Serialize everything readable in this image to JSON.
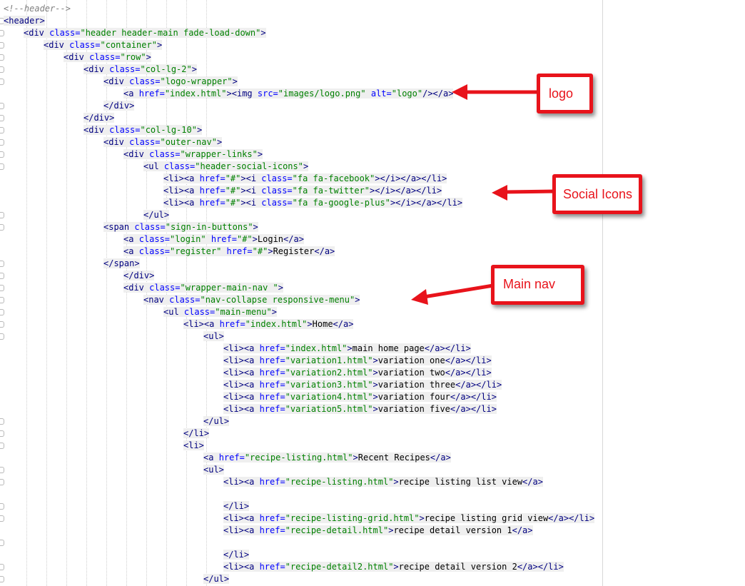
{
  "colors": {
    "tag": "#000080",
    "attr_name": "#0000ff",
    "attr_value": "#008000",
    "comment": "#808080",
    "text": "#000000",
    "annotation": "#e8131b"
  },
  "code_lines": [
    {
      "tokens": [
        {
          "t": "cm",
          "v": "<!--header-->"
        }
      ]
    },
    {
      "tokens": [
        {
          "t": "tag",
          "v": "<header>"
        }
      ]
    },
    {
      "tokens": [
        {
          "t": "tag",
          "v": "<div "
        },
        {
          "t": "an",
          "v": "class="
        },
        {
          "t": "av",
          "v": "\"header header-main fade-load-down\""
        },
        {
          "t": "tag",
          "v": ">"
        }
      ]
    },
    {
      "tokens": [
        {
          "t": "tag",
          "v": "<div "
        },
        {
          "t": "an",
          "v": "class="
        },
        {
          "t": "av",
          "v": "\"container\""
        },
        {
          "t": "tag",
          "v": ">"
        }
      ]
    },
    {
      "tokens": [
        {
          "t": "tag",
          "v": "<div "
        },
        {
          "t": "an",
          "v": "class="
        },
        {
          "t": "av",
          "v": "\"row\""
        },
        {
          "t": "tag",
          "v": ">"
        }
      ]
    },
    {
      "tokens": [
        {
          "t": "tag",
          "v": "<div "
        },
        {
          "t": "an",
          "v": "class="
        },
        {
          "t": "av",
          "v": "\"col-lg-2\""
        },
        {
          "t": "tag",
          "v": ">"
        }
      ]
    },
    {
      "tokens": [
        {
          "t": "tag",
          "v": "<div "
        },
        {
          "t": "an",
          "v": "class="
        },
        {
          "t": "av",
          "v": "\"logo-wrapper\""
        },
        {
          "t": "tag",
          "v": ">"
        }
      ]
    },
    {
      "tokens": [
        {
          "t": "tag",
          "v": "<a "
        },
        {
          "t": "an",
          "v": "href="
        },
        {
          "t": "av",
          "v": "\"index.html\""
        },
        {
          "t": "tag",
          "v": "><img "
        },
        {
          "t": "an",
          "v": "src="
        },
        {
          "t": "av",
          "v": "\"images/logo.png\""
        },
        {
          "t": "tag",
          "v": " "
        },
        {
          "t": "an",
          "v": "alt="
        },
        {
          "t": "av",
          "v": "\"logo\""
        },
        {
          "t": "tag",
          "v": "/></a>"
        }
      ]
    },
    {
      "tokens": [
        {
          "t": "tag",
          "v": "</div>"
        }
      ]
    },
    {
      "tokens": [
        {
          "t": "tag",
          "v": "</div>"
        }
      ]
    },
    {
      "tokens": [
        {
          "t": "tag",
          "v": "<div "
        },
        {
          "t": "an",
          "v": "class="
        },
        {
          "t": "av",
          "v": "\"col-lg-10\""
        },
        {
          "t": "tag",
          "v": ">"
        }
      ]
    },
    {
      "tokens": [
        {
          "t": "tag",
          "v": "<div "
        },
        {
          "t": "an",
          "v": "class="
        },
        {
          "t": "av",
          "v": "\"outer-nav\""
        },
        {
          "t": "tag",
          "v": ">"
        }
      ]
    },
    {
      "tokens": [
        {
          "t": "tag",
          "v": "<div "
        },
        {
          "t": "an",
          "v": "class="
        },
        {
          "t": "av",
          "v": "\"wrapper-links\""
        },
        {
          "t": "tag",
          "v": ">"
        }
      ]
    },
    {
      "tokens": [
        {
          "t": "tag",
          "v": "<ul "
        },
        {
          "t": "an",
          "v": "class="
        },
        {
          "t": "av",
          "v": "\"header-social-icons\""
        },
        {
          "t": "tag",
          "v": ">"
        }
      ]
    },
    {
      "tokens": [
        {
          "t": "tag",
          "v": "<li><a "
        },
        {
          "t": "an",
          "v": "href="
        },
        {
          "t": "av",
          "v": "\"#\""
        },
        {
          "t": "tag",
          "v": "><i "
        },
        {
          "t": "an",
          "v": "class="
        },
        {
          "t": "av",
          "v": "\"fa fa-facebook\""
        },
        {
          "t": "tag",
          "v": "></i></a></li>"
        }
      ]
    },
    {
      "tokens": [
        {
          "t": "tag",
          "v": "<li><a "
        },
        {
          "t": "an",
          "v": "href="
        },
        {
          "t": "av",
          "v": "\"#\""
        },
        {
          "t": "tag",
          "v": "><i "
        },
        {
          "t": "an",
          "v": "class="
        },
        {
          "t": "av",
          "v": "\"fa fa-twitter\""
        },
        {
          "t": "tag",
          "v": "></i></a></li>"
        }
      ]
    },
    {
      "tokens": [
        {
          "t": "tag",
          "v": "<li><a "
        },
        {
          "t": "an",
          "v": "href="
        },
        {
          "t": "av",
          "v": "\"#\""
        },
        {
          "t": "tag",
          "v": "><i "
        },
        {
          "t": "an",
          "v": "class="
        },
        {
          "t": "av",
          "v": "\"fa fa-google-plus\""
        },
        {
          "t": "tag",
          "v": "></i></a></li>"
        }
      ]
    },
    {
      "tokens": [
        {
          "t": "tag",
          "v": "</ul>"
        }
      ]
    },
    {
      "tokens": [
        {
          "t": "tag",
          "v": "<span "
        },
        {
          "t": "an",
          "v": "class="
        },
        {
          "t": "av",
          "v": "\"sign-in-buttons\""
        },
        {
          "t": "tag",
          "v": ">"
        }
      ]
    },
    {
      "tokens": [
        {
          "t": "tag",
          "v": "<a "
        },
        {
          "t": "an",
          "v": "class="
        },
        {
          "t": "av",
          "v": "\"login\""
        },
        {
          "t": "tag",
          "v": " "
        },
        {
          "t": "an",
          "v": "href="
        },
        {
          "t": "av",
          "v": "\"#\""
        },
        {
          "t": "tag",
          "v": ">"
        },
        {
          "t": "tx",
          "v": "Login"
        },
        {
          "t": "tag",
          "v": "</a>"
        }
      ]
    },
    {
      "tokens": [
        {
          "t": "tag",
          "v": "<a "
        },
        {
          "t": "an",
          "v": "class="
        },
        {
          "t": "av",
          "v": "\"register\""
        },
        {
          "t": "tag",
          "v": " "
        },
        {
          "t": "an",
          "v": "href="
        },
        {
          "t": "av",
          "v": "\"#\""
        },
        {
          "t": "tag",
          "v": ">"
        },
        {
          "t": "tx",
          "v": "Register"
        },
        {
          "t": "tag",
          "v": "</a>"
        }
      ]
    },
    {
      "tokens": [
        {
          "t": "tag",
          "v": "</span>"
        }
      ]
    },
    {
      "tokens": [
        {
          "t": "tag",
          "v": "</div>"
        }
      ]
    },
    {
      "tokens": [
        {
          "t": "tag",
          "v": "<div "
        },
        {
          "t": "an",
          "v": "class="
        },
        {
          "t": "av",
          "v": "\"wrapper-main-nav \""
        },
        {
          "t": "tag",
          "v": ">"
        }
      ]
    },
    {
      "tokens": [
        {
          "t": "tag",
          "v": "<nav "
        },
        {
          "t": "an",
          "v": "class="
        },
        {
          "t": "av",
          "v": "\"nav-collapse responsive-menu\""
        },
        {
          "t": "tag",
          "v": ">"
        }
      ]
    },
    {
      "tokens": [
        {
          "t": "tag",
          "v": "<ul "
        },
        {
          "t": "an",
          "v": "class="
        },
        {
          "t": "av",
          "v": "\"main-menu\""
        },
        {
          "t": "tag",
          "v": ">"
        }
      ]
    },
    {
      "tokens": [
        {
          "t": "tag",
          "v": "<li><a "
        },
        {
          "t": "an",
          "v": "href="
        },
        {
          "t": "av",
          "v": "\"index.html\""
        },
        {
          "t": "tag",
          "v": ">"
        },
        {
          "t": "tx",
          "v": "Home"
        },
        {
          "t": "tag",
          "v": "</a>"
        }
      ]
    },
    {
      "tokens": [
        {
          "t": "tag",
          "v": "<ul>"
        }
      ]
    },
    {
      "tokens": [
        {
          "t": "tag",
          "v": "<li><a "
        },
        {
          "t": "an",
          "v": "href="
        },
        {
          "t": "av",
          "v": "\"index.html\""
        },
        {
          "t": "tag",
          "v": ">"
        },
        {
          "t": "tx",
          "v": "main home page"
        },
        {
          "t": "tag",
          "v": "</a></li>"
        }
      ]
    },
    {
      "tokens": [
        {
          "t": "tag",
          "v": "<li><a "
        },
        {
          "t": "an",
          "v": "href="
        },
        {
          "t": "av",
          "v": "\"variation1.html\""
        },
        {
          "t": "tag",
          "v": ">"
        },
        {
          "t": "tx",
          "v": "variation one"
        },
        {
          "t": "tag",
          "v": "</a></li>"
        }
      ]
    },
    {
      "tokens": [
        {
          "t": "tag",
          "v": "<li><a "
        },
        {
          "t": "an",
          "v": "href="
        },
        {
          "t": "av",
          "v": "\"variation2.html\""
        },
        {
          "t": "tag",
          "v": ">"
        },
        {
          "t": "tx",
          "v": "variation two"
        },
        {
          "t": "tag",
          "v": "</a></li>"
        }
      ]
    },
    {
      "tokens": [
        {
          "t": "tag",
          "v": "<li><a "
        },
        {
          "t": "an",
          "v": "href="
        },
        {
          "t": "av",
          "v": "\"variation3.html\""
        },
        {
          "t": "tag",
          "v": ">"
        },
        {
          "t": "tx",
          "v": "variation three"
        },
        {
          "t": "tag",
          "v": "</a></li>"
        }
      ]
    },
    {
      "tokens": [
        {
          "t": "tag",
          "v": "<li><a "
        },
        {
          "t": "an",
          "v": "href="
        },
        {
          "t": "av",
          "v": "\"variation4.html\""
        },
        {
          "t": "tag",
          "v": ">"
        },
        {
          "t": "tx",
          "v": "variation four"
        },
        {
          "t": "tag",
          "v": "</a></li>"
        }
      ]
    },
    {
      "tokens": [
        {
          "t": "tag",
          "v": "<li><a "
        },
        {
          "t": "an",
          "v": "href="
        },
        {
          "t": "av",
          "v": "\"variation5.html\""
        },
        {
          "t": "tag",
          "v": ">"
        },
        {
          "t": "tx",
          "v": "variation five"
        },
        {
          "t": "tag",
          "v": "</a></li>"
        }
      ]
    },
    {
      "tokens": [
        {
          "t": "tag",
          "v": "</ul>"
        }
      ]
    },
    {
      "tokens": [
        {
          "t": "tag",
          "v": "</li>"
        }
      ]
    },
    {
      "tokens": [
        {
          "t": "tag",
          "v": "<li>"
        }
      ]
    },
    {
      "tokens": [
        {
          "t": "tag",
          "v": "<a "
        },
        {
          "t": "an",
          "v": "href="
        },
        {
          "t": "av",
          "v": "\"recipe-listing.html\""
        },
        {
          "t": "tag",
          "v": ">"
        },
        {
          "t": "tx",
          "v": "Recent Recipes"
        },
        {
          "t": "tag",
          "v": "</a>"
        }
      ]
    },
    {
      "tokens": [
        {
          "t": "tag",
          "v": "<ul>"
        }
      ]
    },
    {
      "tokens": [
        {
          "t": "tag",
          "v": "<li><a "
        },
        {
          "t": "an",
          "v": "href="
        },
        {
          "t": "av",
          "v": "\"recipe-listing.html\""
        },
        {
          "t": "tag",
          "v": ">"
        },
        {
          "t": "tx",
          "v": "recipe listing list view"
        },
        {
          "t": "tag",
          "v": "</a>"
        }
      ]
    },
    {
      "tokens": []
    },
    {
      "tokens": [
        {
          "t": "tag",
          "v": "</li>"
        }
      ]
    },
    {
      "tokens": [
        {
          "t": "tag",
          "v": "<li><a "
        },
        {
          "t": "an",
          "v": "href="
        },
        {
          "t": "av",
          "v": "\"recipe-listing-grid.html\""
        },
        {
          "t": "tag",
          "v": ">"
        },
        {
          "t": "tx",
          "v": "recipe listing grid view"
        },
        {
          "t": "tag",
          "v": "</a></li>"
        }
      ]
    },
    {
      "tokens": [
        {
          "t": "tag",
          "v": "<li><a "
        },
        {
          "t": "an",
          "v": "href="
        },
        {
          "t": "av",
          "v": "\"recipe-detail.html\""
        },
        {
          "t": "tag",
          "v": ">"
        },
        {
          "t": "tx",
          "v": "recipe detail version 1"
        },
        {
          "t": "tag",
          "v": "</a>"
        }
      ]
    },
    {
      "tokens": []
    },
    {
      "tokens": [
        {
          "t": "tag",
          "v": "</li>"
        }
      ]
    },
    {
      "tokens": [
        {
          "t": "tag",
          "v": "<li><a "
        },
        {
          "t": "an",
          "v": "href="
        },
        {
          "t": "av",
          "v": "\"recipe-detail2.html\""
        },
        {
          "t": "tag",
          "v": ">"
        },
        {
          "t": "tx",
          "v": "recipe detail version 2"
        },
        {
          "t": "tag",
          "v": "</a></li>"
        }
      ]
    },
    {
      "tokens": [
        {
          "t": "tag",
          "v": "</ul>"
        }
      ]
    }
  ],
  "annotations": [
    {
      "id": "logo",
      "label": "logo"
    },
    {
      "id": "social",
      "label": "Social Icons"
    },
    {
      "id": "mainnav",
      "label": "Main nav"
    }
  ]
}
